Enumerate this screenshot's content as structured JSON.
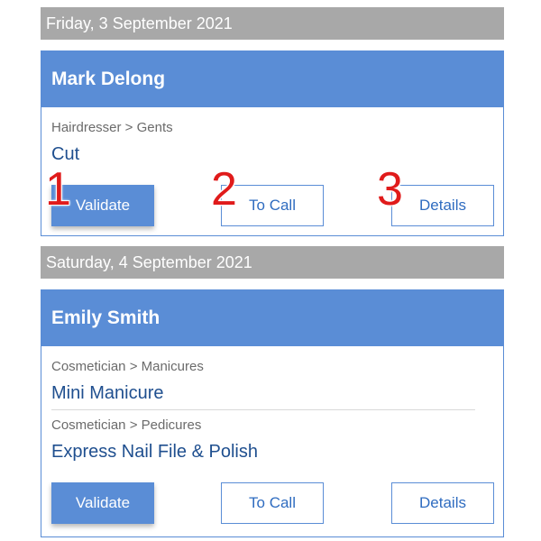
{
  "appointments": [
    {
      "date": "Friday, 3 September 2021",
      "client": "Mark Delong",
      "services": [
        {
          "category": "Hairdresser > Gents",
          "name": "Cut"
        }
      ],
      "buttons": {
        "validate": "Validate",
        "call": "To Call",
        "details": "Details"
      }
    },
    {
      "date": "Saturday, 4 September 2021",
      "client": "Emily Smith",
      "services": [
        {
          "category": "Cosmetician > Manicures",
          "name": "Mini Manicure"
        },
        {
          "category": "Cosmetician > Pedicures",
          "name": "Express Nail File & Polish"
        }
      ],
      "buttons": {
        "validate": "Validate",
        "call": "To Call",
        "details": "Details"
      }
    }
  ],
  "step_markers": [
    "1",
    "2",
    "3"
  ],
  "colors": {
    "accent": "#5a8dd6",
    "date_bar": "#a8a8a8",
    "service_name": "#1f4f8f",
    "marker": "#e01b1b"
  }
}
